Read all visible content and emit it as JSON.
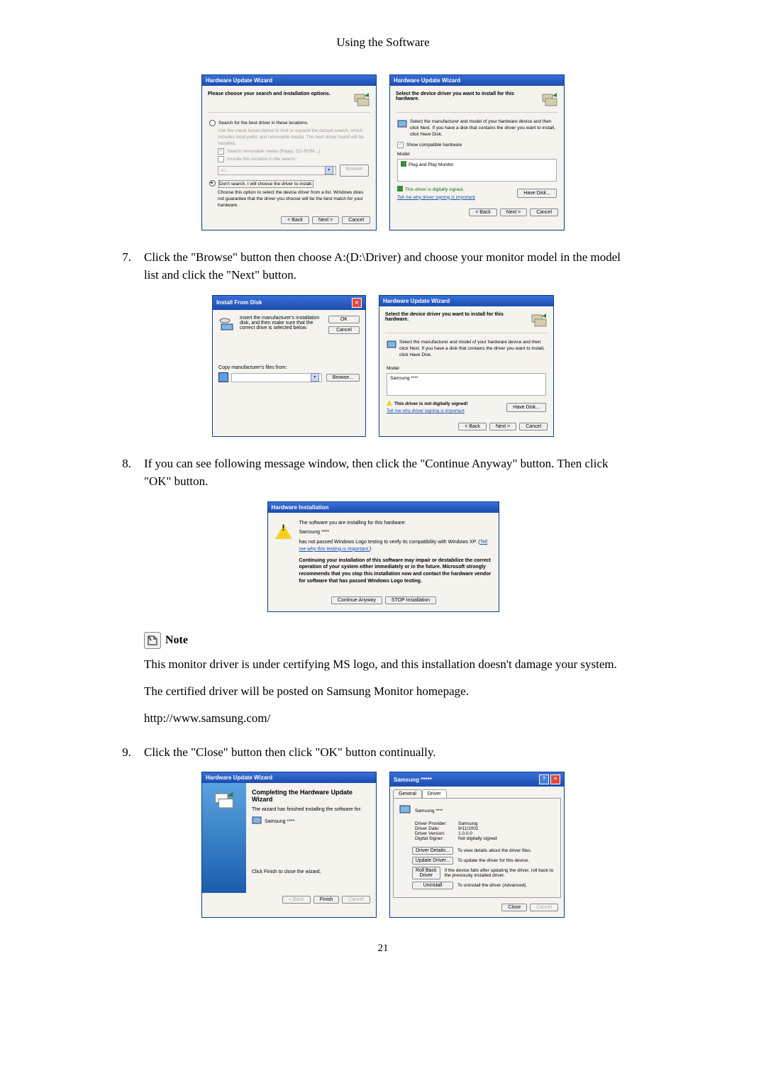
{
  "header": "Using the Software",
  "wiz1": {
    "title": "Hardware Update Wizard",
    "subhead": "Please choose your search and installation options.",
    "opt1": "Search for the best driver in these locations.",
    "opt1_desc": "Use the check boxes below to limit or expand the default search, which includes local paths and removable media. The best driver found will be installed.",
    "chk1": "Search removable media (floppy, CD-ROM...)",
    "chk2": "Include this location in the search:",
    "drive": "A:\\",
    "browse_btn": "Browse",
    "opt2": "Don't search. I will choose the driver to install.",
    "opt2_desc": "Choose this option to select the device driver from a list. Windows does not guarantee that the driver you choose will be the best match for your hardware.",
    "back": "< Back",
    "next": "Next >",
    "cancel": "Cancel"
  },
  "wiz2": {
    "title": "Hardware Update Wizard",
    "subhead": "Select the device driver you want to install for this hardware.",
    "desc": "Select the manufacturer and model of your hardware device and then click Next. If you have a disk that contains the driver you want to install, click Have Disk.",
    "show_compat": "Show compatible hardware",
    "model_lbl": "Model",
    "model_val": "Plug and Play Monitor",
    "signed": "This driver is digitally signed.",
    "signing_link": "Tell me why driver signing is important",
    "have_disk": "Have Disk...",
    "back": "< Back",
    "next": "Next >",
    "cancel": "Cancel"
  },
  "step7": "Click the \"Browse\" button then choose A:(D:\\Driver) and choose your monitor model in the model list and click the \"Next\" button.",
  "install_disk": {
    "title": "Install From Disk",
    "text": "Insert the manufacturer's installation disk, and then make sure that the correct drive is selected below.",
    "ok": "OK",
    "cancel": "Cancel",
    "copy_lbl": "Copy manufacturer's files from:",
    "browse": "Browse..."
  },
  "wiz3": {
    "title": "Hardware Update Wizard",
    "subhead": "Select the device driver you want to install for this hardware.",
    "desc": "Select the manufacturer and model of your hardware device and then click Next. If you have a disk that contains the driver you want to install, click Have Disk.",
    "model_lbl": "Model",
    "model_val": "Samsung ****",
    "not_signed": "This driver is not digitally signed!",
    "signing_link": "Tell me why driver signing is important",
    "have_disk": "Have Disk...",
    "back": "< Back",
    "next": "Next >",
    "cancel": "Cancel"
  },
  "step8": "If you can see following message window, then click the \"Continue Anyway\" button. Then click \"OK\" button.",
  "hw_install": {
    "title": "Hardware Installation",
    "line1": "The software you are installing for this hardware:",
    "device": "Samsung ****",
    "line2a": "has not passed Windows Logo testing to verify its compatibility with Windows XP. (",
    "line2_link": "Tell me why this testing is important.",
    "line2b": ")",
    "bold": "Continuing your installation of this software may impair or destabilize the correct operation of your system either immediately or in the future. Microsoft strongly recommends that you stop this installation now and contact the hardware vendor for software that has passed Windows Logo testing.",
    "continue_btn": "Continue Anyway",
    "stop_btn": "STOP Installation"
  },
  "note": {
    "label": "Note",
    "p1": "This monitor driver is under certifying MS logo, and this installation doesn't damage your system.",
    "p2": "The certified driver will be posted on Samsung Monitor homepage.",
    "p3": "http://www.samsung.com/"
  },
  "step9": "Click the \"Close\" button then click \"OK\" button continually.",
  "wiz_done": {
    "title": "Hardware Update Wizard",
    "heading": "Completing the Hardware Update Wizard",
    "done_text": "The wizard has finished installing the software for:",
    "device": "Samsung ****",
    "close_text": "Click Finish to close the wizard.",
    "back": "< Back",
    "finish": "Finish",
    "cancel": "Cancel"
  },
  "props": {
    "title": "Samsung *****",
    "tab_general": "General",
    "tab_driver": "Driver",
    "device": "Samsung ****",
    "provider_lbl": "Driver Provider:",
    "provider": "Samsung",
    "date_lbl": "Driver Date:",
    "date": "9/11/2001",
    "version_lbl": "Driver Version:",
    "version": "1.0.0.0",
    "signer_lbl": "Digital Signer:",
    "signer": "Not digitally signed",
    "details_btn": "Driver Details...",
    "details_desc": "To view details about the driver files.",
    "update_btn": "Update Driver...",
    "update_desc": "To update the driver for this device.",
    "rollback_btn": "Roll Back Driver",
    "rollback_desc": "If the device fails after updating the driver, roll back to the previously installed driver.",
    "uninstall_btn": "Uninstall",
    "uninstall_desc": "To uninstall the driver (Advanced).",
    "close": "Close",
    "cancel": "Cancel"
  },
  "page_num": "21"
}
